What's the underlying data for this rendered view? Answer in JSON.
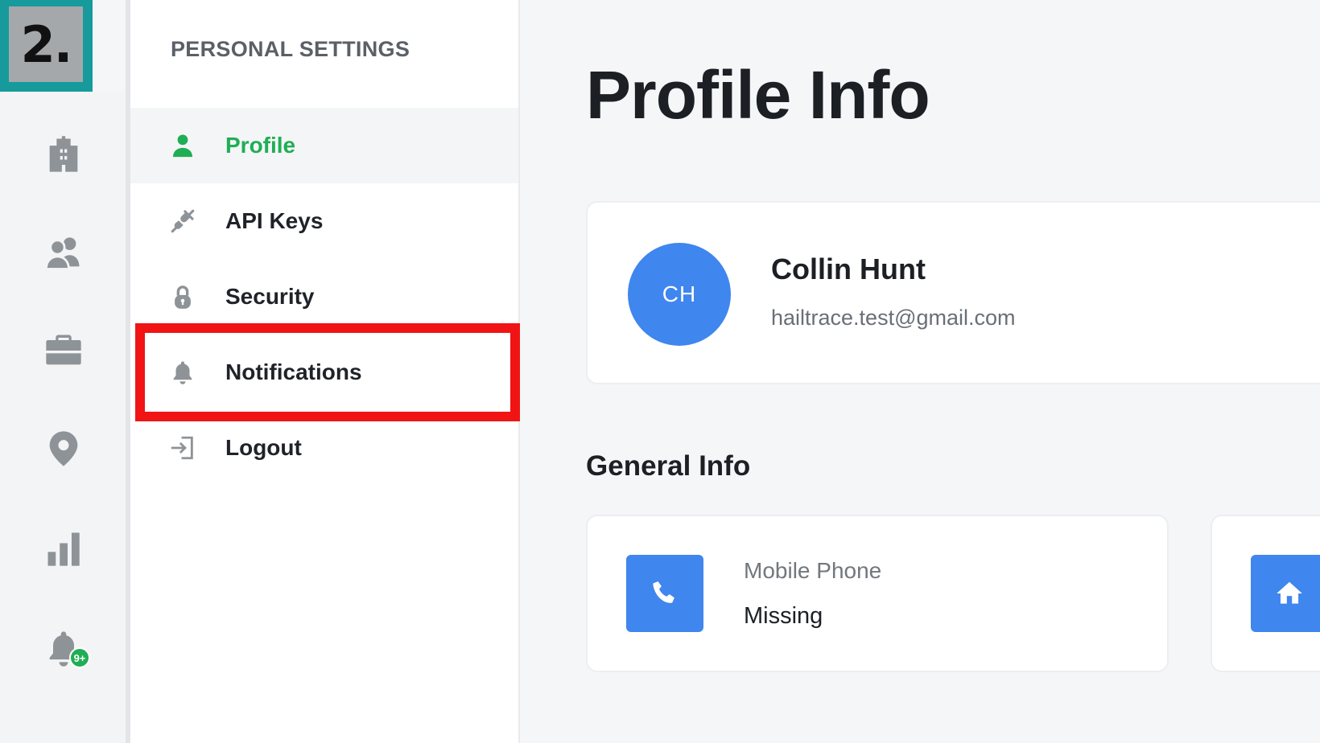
{
  "step_badge": {
    "text": "2."
  },
  "rail": {
    "icons": [
      {
        "name": "building-icon"
      },
      {
        "name": "users-icon"
      },
      {
        "name": "briefcase-icon"
      },
      {
        "name": "map-pin-icon"
      },
      {
        "name": "bar-chart-icon"
      },
      {
        "name": "bell-icon"
      }
    ],
    "notification_badge": "9+"
  },
  "settings": {
    "heading": "PERSONAL SETTINGS",
    "items": [
      {
        "label": "Profile",
        "icon": "user-icon",
        "active": true
      },
      {
        "label": "API Keys",
        "icon": "plug-icon",
        "active": false
      },
      {
        "label": "Security",
        "icon": "lock-icon",
        "active": false
      },
      {
        "label": "Notifications",
        "icon": "bell-icon",
        "active": false
      },
      {
        "label": "Logout",
        "icon": "logout-icon",
        "active": false
      }
    ]
  },
  "main": {
    "title": "Profile Info",
    "profile": {
      "initials": "CH",
      "name": "Collin Hunt",
      "email": "hailtrace.test@gmail.com"
    },
    "general_info": {
      "title": "General Info",
      "cards": [
        {
          "label": "Mobile Phone",
          "value": "Missing",
          "icon": "phone-icon"
        },
        {
          "label": "",
          "value": "",
          "icon": "home-icon"
        }
      ]
    }
  },
  "colors": {
    "accent_green": "#1fae55",
    "accent_blue": "#3f86ee",
    "highlight_red": "#f01414",
    "badge_teal": "#169a9c"
  }
}
